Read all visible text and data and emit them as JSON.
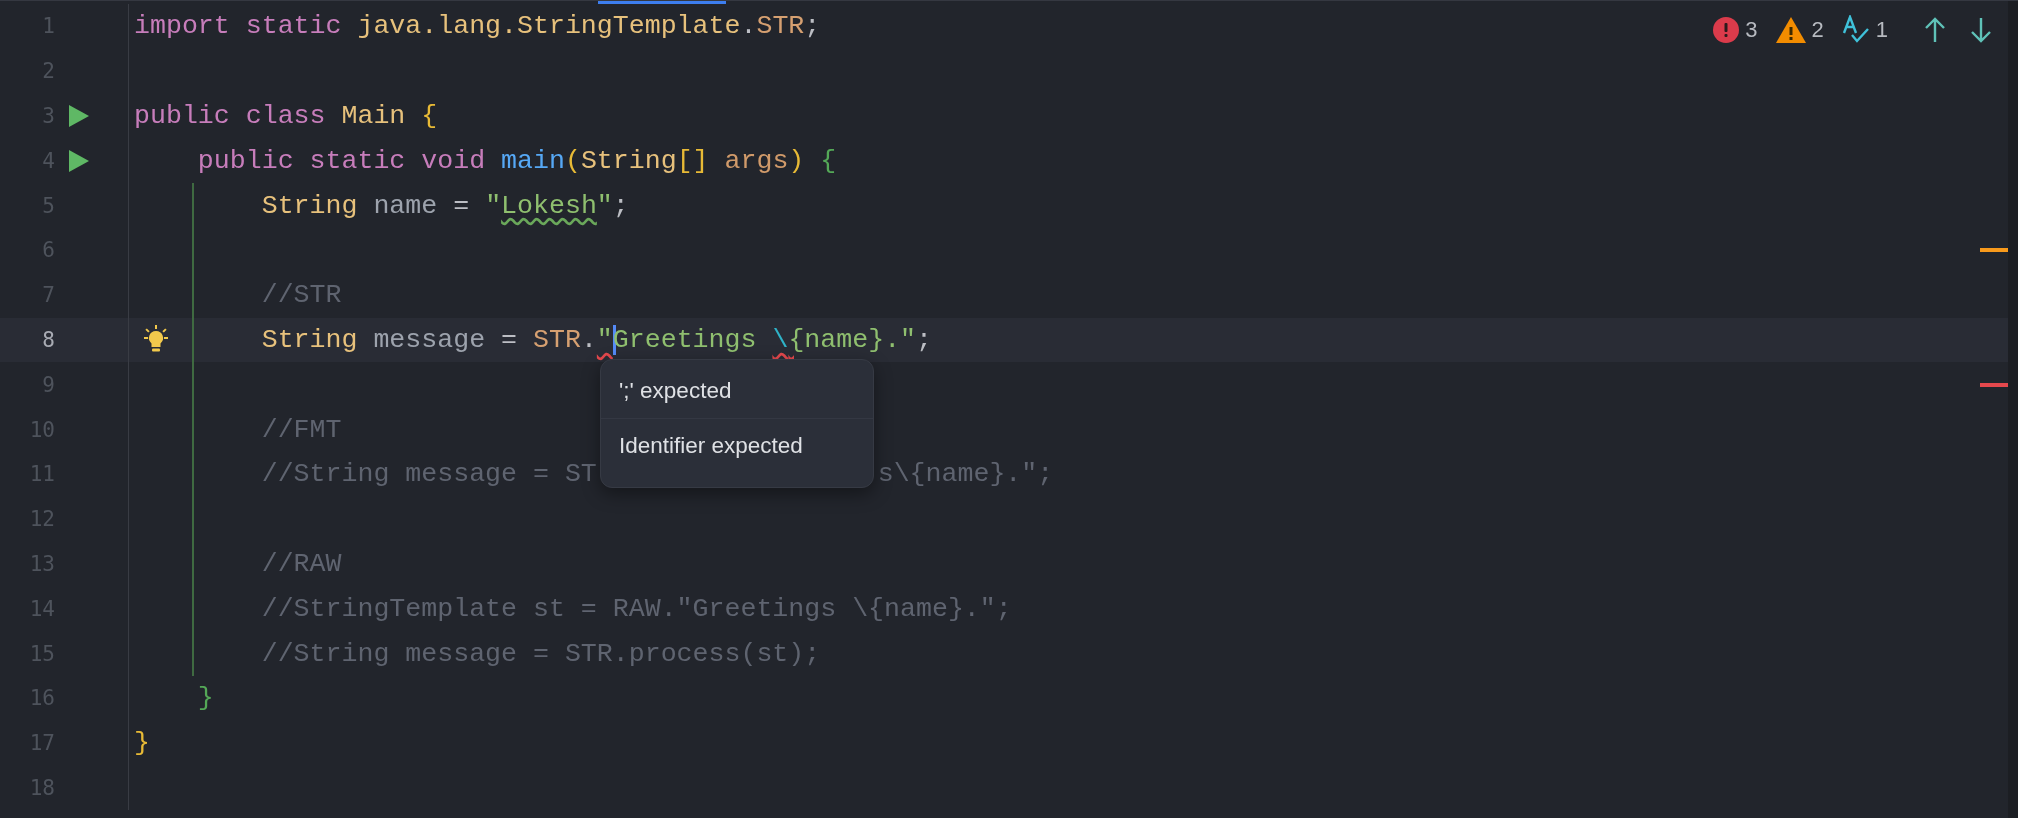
{
  "inspections": {
    "errors": "3",
    "warnings": "2",
    "typos": "1"
  },
  "lines": [
    {
      "n": "1",
      "current": false,
      "run": false,
      "bulb": false,
      "guide": false,
      "tokens": [
        {
          "text": "import static ",
          "kind": "keyword"
        },
        {
          "text": "java.lang.StringTemplate",
          "kind": "type"
        },
        {
          "text": ".",
          "kind": "plain"
        },
        {
          "text": "STR",
          "kind": "static"
        },
        {
          "text": ";",
          "kind": "plain"
        }
      ]
    },
    {
      "n": "2",
      "current": false,
      "run": false,
      "bulb": false,
      "guide": false
    },
    {
      "n": "3",
      "current": false,
      "run": true,
      "bulb": false,
      "guide": false,
      "tokens": [
        {
          "text": "public class ",
          "kind": "keyword"
        },
        {
          "text": "Main ",
          "kind": "type"
        },
        {
          "text": "{",
          "kind": "brace1"
        }
      ]
    },
    {
      "n": "4",
      "current": false,
      "run": true,
      "bulb": false,
      "guide": false,
      "tokens": [
        {
          "text": "    public static void ",
          "kind": "keyword"
        },
        {
          "text": "main",
          "kind": "method"
        },
        {
          "text": "(",
          "kind": "brace1"
        },
        {
          "text": "String",
          "kind": "type"
        },
        {
          "text": "[]",
          "kind": "brace1"
        },
        {
          "text": " args",
          "kind": "param"
        },
        {
          "text": ")",
          "kind": "brace1"
        },
        {
          "text": " {",
          "kind": "brace2"
        }
      ]
    },
    {
      "n": "5",
      "current": false,
      "run": false,
      "bulb": false,
      "guide": true,
      "tokens": [
        {
          "text": "        String",
          "kind": "type"
        },
        {
          "text": " name ",
          "kind": "var"
        },
        {
          "text": "= ",
          "kind": "plain"
        },
        {
          "text": "\"",
          "kind": "string"
        },
        {
          "text": "Lokesh",
          "kind": "string",
          "typo": true
        },
        {
          "text": "\"",
          "kind": "string"
        },
        {
          "text": ";",
          "kind": "plain"
        }
      ]
    },
    {
      "n": "6",
      "current": false,
      "run": false,
      "bulb": false,
      "guide": true,
      "marker": {
        "color": "#f89a1c"
      }
    },
    {
      "n": "7",
      "current": false,
      "run": false,
      "bulb": false,
      "guide": true,
      "tokens": [
        {
          "text": "        //STR",
          "kind": "comment"
        }
      ]
    },
    {
      "n": "8",
      "current": true,
      "run": false,
      "bulb": true,
      "guide": true,
      "tokens": [
        {
          "text": "        String",
          "kind": "type"
        },
        {
          "text": " message ",
          "kind": "var"
        },
        {
          "text": "= ",
          "kind": "plain"
        },
        {
          "text": "STR",
          "kind": "static"
        },
        {
          "text": ".",
          "kind": "plain"
        },
        {
          "text": "\"",
          "kind": "string",
          "error": true
        },
        {
          "text": "Greetings ",
          "kind": "string",
          "caret": true
        },
        {
          "text": "\\",
          "kind": "escape",
          "error": true
        },
        {
          "text": "{",
          "kind": "string",
          "error": true
        },
        {
          "text": "name}.\"",
          "kind": "string"
        },
        {
          "text": ";",
          "kind": "plain"
        }
      ]
    },
    {
      "n": "9",
      "current": false,
      "run": false,
      "bulb": false,
      "guide": true,
      "marker": {
        "color": "#e5484d"
      }
    },
    {
      "n": "10",
      "current": false,
      "run": false,
      "bulb": false,
      "guide": true,
      "tokens": [
        {
          "text": "        //FMT",
          "kind": "comment"
        }
      ]
    },
    {
      "n": "11",
      "current": false,
      "run": false,
      "bulb": false,
      "guide": true,
      "tokens": [
        {
          "text": "        //String message = ST",
          "kind": "comment"
        },
        {
          "text": "s\\{name}.\";",
          "kind": "comment",
          "after_popup": true
        }
      ]
    },
    {
      "n": "12",
      "current": false,
      "run": false,
      "bulb": false,
      "guide": true
    },
    {
      "n": "13",
      "current": false,
      "run": false,
      "bulb": false,
      "guide": true,
      "tokens": [
        {
          "text": "        //RAW",
          "kind": "comment"
        }
      ]
    },
    {
      "n": "14",
      "current": false,
      "run": false,
      "bulb": false,
      "guide": true,
      "tokens": [
        {
          "text": "        //StringTemplate st = RAW.\"Greetings \\{name}.\";",
          "kind": "comment"
        }
      ]
    },
    {
      "n": "15",
      "current": false,
      "run": false,
      "bulb": false,
      "guide": true,
      "tokens": [
        {
          "text": "        //String message = STR.process(st);",
          "kind": "comment"
        }
      ]
    },
    {
      "n": "16",
      "current": false,
      "run": false,
      "bulb": false,
      "guide": false,
      "tokens": [
        {
          "text": "    }",
          "kind": "brace2"
        }
      ]
    },
    {
      "n": "17",
      "current": false,
      "run": false,
      "bulb": false,
      "guide": false,
      "tokens": [
        {
          "text": "}",
          "kind": "brace1"
        }
      ]
    },
    {
      "n": "18",
      "current": false,
      "run": false,
      "bulb": false,
      "guide": false
    }
  ],
  "popup": {
    "items": [
      "';' expected",
      "Identifier expected"
    ]
  }
}
